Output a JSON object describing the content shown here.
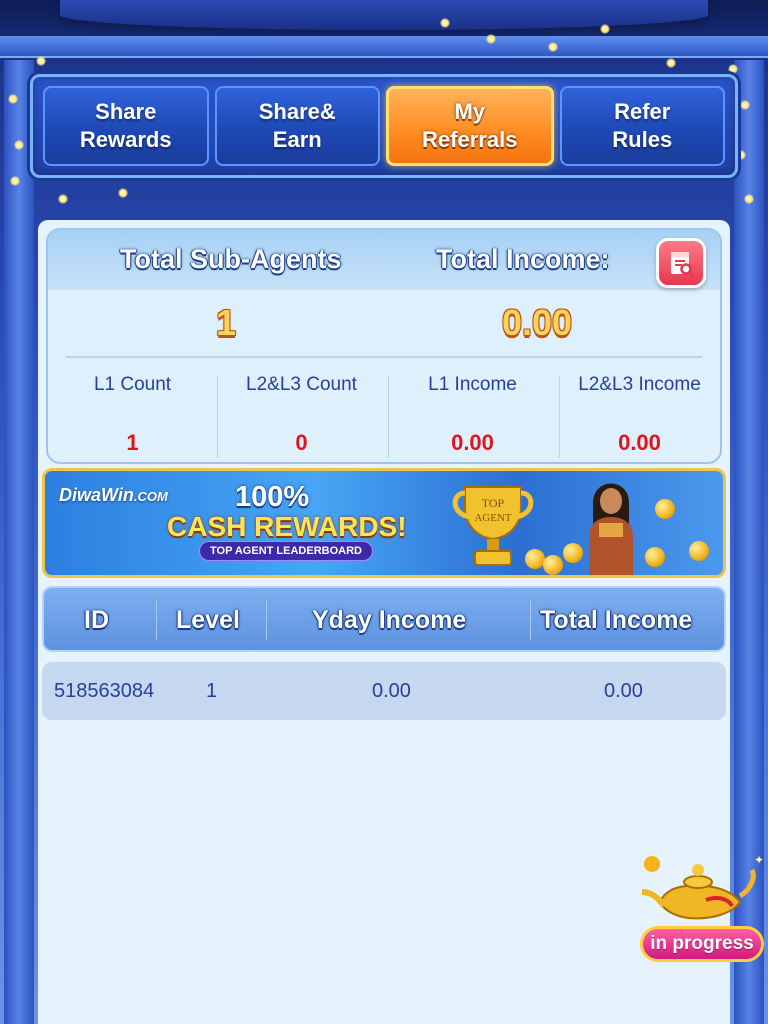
{
  "tabs": [
    {
      "label": "Share\nRewards",
      "active": false
    },
    {
      "label": "Share&\nEarn",
      "active": false
    },
    {
      "label": "My\nReferrals",
      "active": true
    },
    {
      "label": "Refer\nRules",
      "active": false
    }
  ],
  "summary": {
    "total_sub_agents_label": "Total Sub-Agents",
    "total_income_label": "Total Income:",
    "total_sub_agents_value": "1",
    "total_income_value": "0.00",
    "records_icon": "document-search-icon"
  },
  "stats": [
    {
      "label": "L1 Count",
      "value": "1"
    },
    {
      "label": "L2&L3 Count",
      "value": "0"
    },
    {
      "label": "L1 Income",
      "value": "0.00"
    },
    {
      "label": "L2&L3 Income",
      "value": "0.00"
    }
  ],
  "banner": {
    "brand": "DiwaWin",
    "brand_suffix": ".COM",
    "headline_1": "100%",
    "headline_2": "CASH REWARDS!",
    "tag": "TOP AGENT LEADERBOARD",
    "trophy_text_1": "TOP",
    "trophy_text_2": "AGENT"
  },
  "table": {
    "headers": [
      "ID",
      "Level",
      "Yday Income",
      "Total Income"
    ],
    "rows": [
      {
        "id": "518563084",
        "level": "1",
        "yday_income": "0.00",
        "total_income": "0.00"
      }
    ]
  },
  "floating": {
    "status": "in progress",
    "icon": "magic-lamp-icon"
  },
  "colors": {
    "active_tab": "#ff8c22",
    "tab": "#1e49b6",
    "value_red": "#e0141f",
    "panel_bg": "#e6f3fc",
    "header_text_outline": "#1a3c85"
  }
}
